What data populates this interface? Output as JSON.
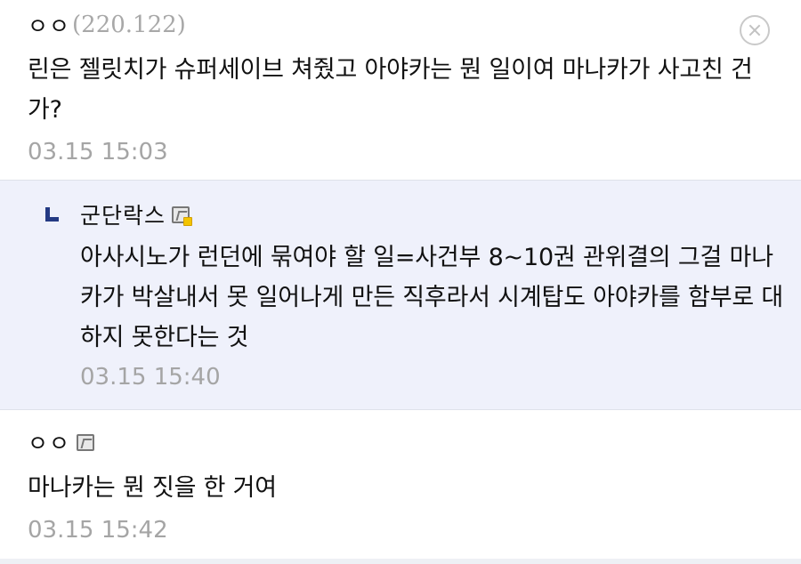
{
  "comments": [
    {
      "author": "ㅇㅇ",
      "ip": "(220.122)",
      "text": "린은 젤릿치가 슈퍼세이브 쳐줬고 아야카는 뭔 일이여 마나카가 사고친 건가?",
      "date": "03.15 15:03"
    },
    {
      "author": "ㅇㅇ",
      "text": "마나카는 뭔 짓을 한 거여",
      "date": "03.15 15:42"
    }
  ],
  "reply": {
    "author": "군단락스",
    "text": "아사시노가 런던에 묶여야 할 일=사건부 8~10권 관위결의 그걸 마나카가 박살내서 못 일어나게 만든 직후라서 시계탑도 아야카를 함부로 대하지 못한다는 것",
    "date": "03.15 15:40"
  },
  "icons": {
    "delete": "close-circle-icon",
    "reply": "reply-arrow-icon",
    "member_fixed": "fixed-nickname-icon",
    "member": "nickname-icon"
  },
  "colors": {
    "reply_background": "#eff1fb",
    "reply_icon": "#243a83",
    "date_text": "#a5a5a5",
    "ip_text": "#a8a8a8",
    "fixed_badge": "#f3c400"
  }
}
